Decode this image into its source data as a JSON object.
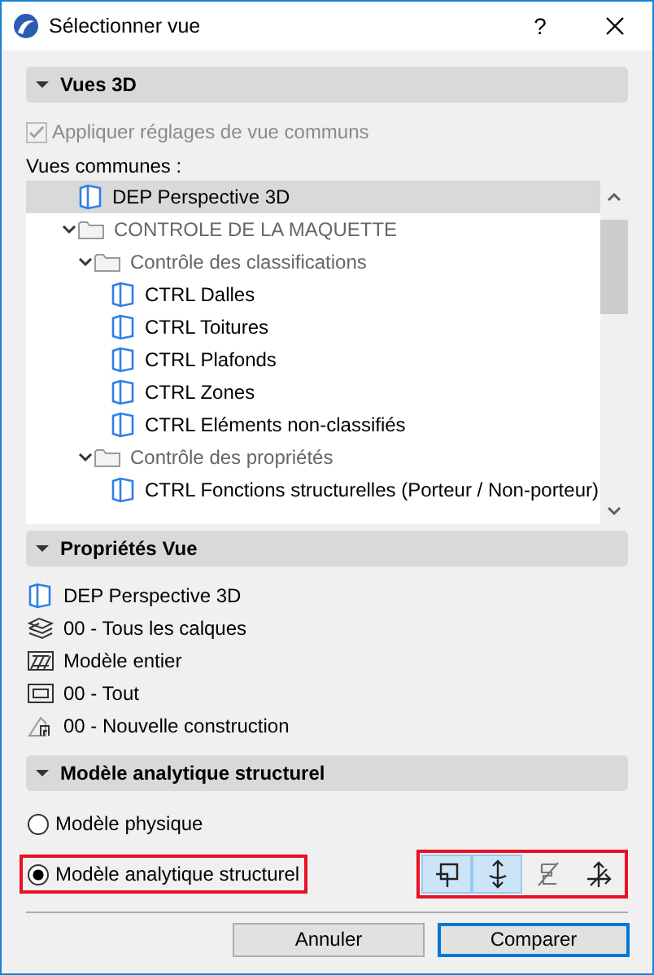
{
  "window": {
    "title": "Sélectionner vue",
    "help": "?"
  },
  "views_section": {
    "title": "Vues 3D",
    "expanded": true,
    "apply_common": {
      "label": "Appliquer réglages de vue communs",
      "checked": true,
      "disabled": true
    },
    "common_views_label": "Vues communes :",
    "tree": [
      {
        "kind": "view",
        "label": "DEP Perspective 3D",
        "selected": true
      },
      {
        "kind": "folder",
        "label": "CONTROLE DE LA MAQUETTE",
        "selected": false,
        "expanded": true,
        "children": [
          {
            "kind": "folder",
            "label": "Contrôle des classifications",
            "selected": false,
            "expanded": true,
            "children": [
              {
                "kind": "view",
                "label": "CTRL Dalles",
                "selected": false
              },
              {
                "kind": "view",
                "label": "CTRL Toitures",
                "selected": false
              },
              {
                "kind": "view",
                "label": "CTRL Plafonds",
                "selected": false
              },
              {
                "kind": "view",
                "label": "CTRL Zones",
                "selected": false
              },
              {
                "kind": "view",
                "label": "CTRL Eléments non-classifiés",
                "selected": false
              }
            ]
          },
          {
            "kind": "folder",
            "label": "Contrôle des propriétés",
            "selected": false,
            "expanded": true,
            "children": [
              {
                "kind": "view",
                "label": "CTRL Fonctions structurelles (Porteur / Non-porteur)",
                "selected": false
              }
            ]
          }
        ]
      }
    ]
  },
  "properties_section": {
    "title": "Propriétés Vue",
    "expanded": true,
    "items": [
      {
        "kind": "view",
        "text": "DEP Perspective 3D"
      },
      {
        "kind": "layers",
        "text": "00 - Tous les calques"
      },
      {
        "kind": "model",
        "text": "Modèle entier"
      },
      {
        "kind": "scale",
        "text": "00 - Tout"
      },
      {
        "kind": "renovation",
        "text": "00 - Nouvelle construction"
      }
    ]
  },
  "analytic_section": {
    "title": "Modèle analytique structurel",
    "expanded": true,
    "radios": [
      {
        "label": "Modèle physique",
        "selected": false,
        "highlighted": false
      },
      {
        "label": "Modèle analytique structurel",
        "selected": true,
        "highlighted": true
      }
    ],
    "tools_highlighted": true,
    "tools": [
      {
        "kind": "members",
        "selected": true
      },
      {
        "kind": "supports",
        "selected": true
      },
      {
        "kind": "surfaces",
        "selected": false
      },
      {
        "kind": "axes",
        "selected": false
      }
    ]
  },
  "buttons": [
    {
      "label": "Annuler",
      "default": false
    },
    {
      "label": "Comparer",
      "default": true
    }
  ]
}
